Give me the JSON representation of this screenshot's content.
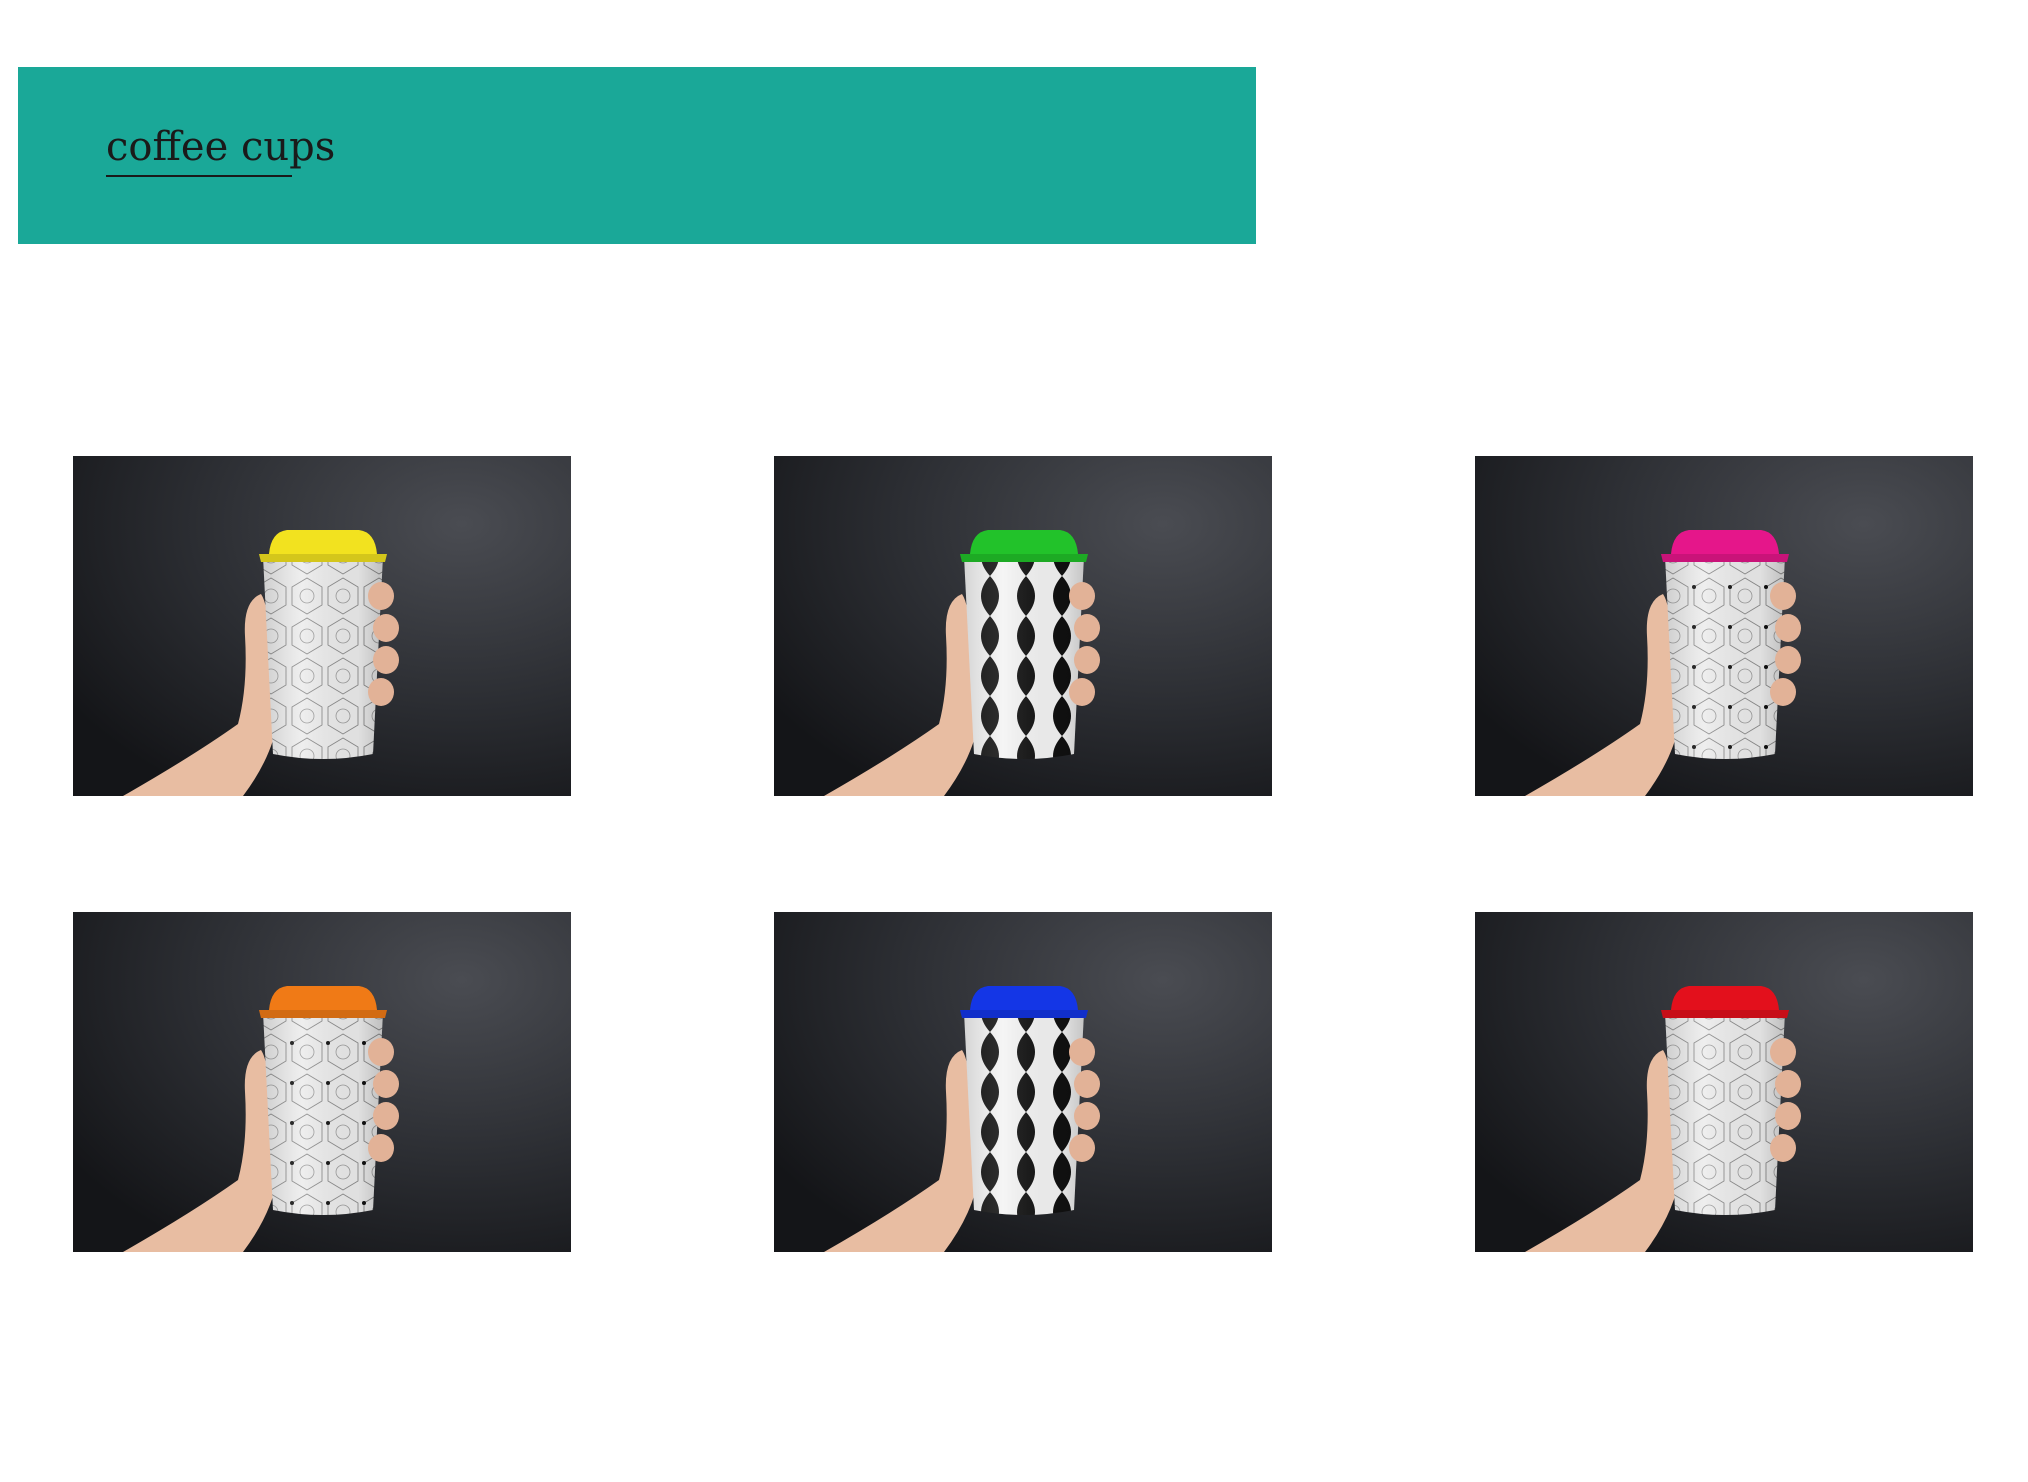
{
  "header": {
    "title": "coffee cups",
    "background_color": "#1aa898"
  },
  "gallery": {
    "items": [
      {
        "lid_color": "#f2e21f",
        "pattern": "light-geometric"
      },
      {
        "lid_color": "#22c22a",
        "pattern": "black-white-bold"
      },
      {
        "lid_color": "#e5168a",
        "pattern": "light-geometric-dots"
      },
      {
        "lid_color": "#f07a16",
        "pattern": "light-geometric-dots"
      },
      {
        "lid_color": "#1436e6",
        "pattern": "black-white-bold"
      },
      {
        "lid_color": "#e3101c",
        "pattern": "light-geometric"
      }
    ]
  }
}
